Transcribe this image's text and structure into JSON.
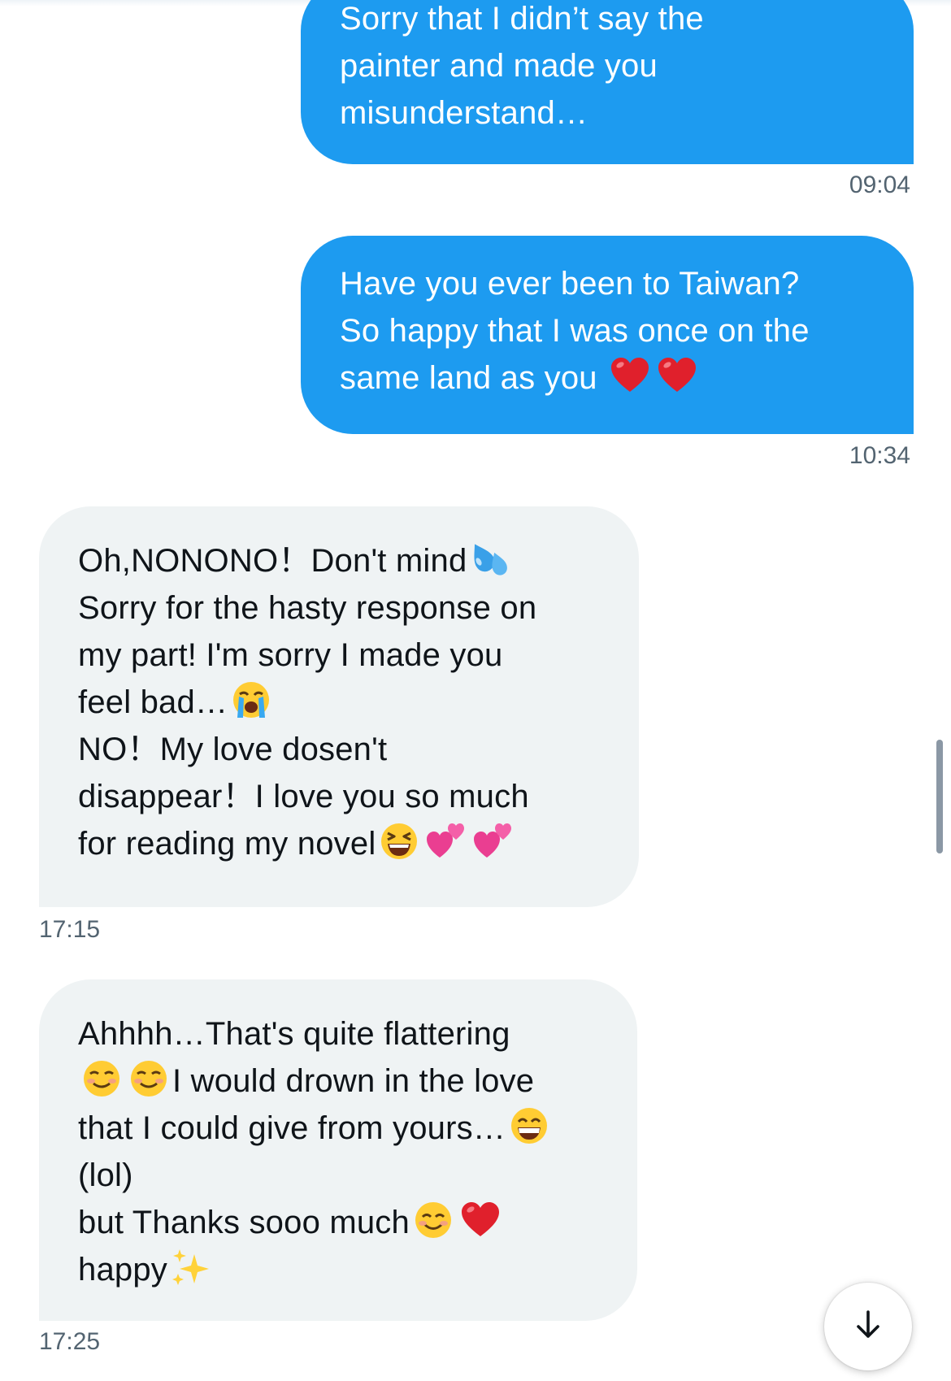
{
  "messages": [
    {
      "direction": "sent",
      "lines": [
        "Sorry that I didn’t say the",
        "painter and made you",
        "misunderstand…"
      ],
      "time": "09:04"
    },
    {
      "direction": "sent",
      "lines": [
        "Have you ever been to Taiwan?",
        "So happy that I was once on the",
        "same land as you"
      ],
      "trailing_emoji": [
        "red-heart",
        "red-heart"
      ],
      "time": "10:34"
    },
    {
      "direction": "received",
      "lines": [
        "Oh,NONONO！Don't mind",
        "Sorry for the hasty response on",
        "my part! I'm sorry I made you",
        "feel bad…",
        "NO！My love dosen't",
        "disappear！I love you so much",
        "for reading my novel"
      ],
      "line_emoji": {
        "0": [
          "sweat-droplets"
        ],
        "3": [
          "loudly-crying-face"
        ],
        "6": [
          "grinning-squinting-face",
          "two-hearts",
          "two-hearts"
        ]
      },
      "time": "17:15"
    },
    {
      "direction": "received",
      "lines": [
        "Ahhhh…That's quite flattering",
        "I would drown in the love",
        "that I could give from yours…",
        "(lol)",
        "but Thanks sooo much",
        "happy"
      ],
      "time": "17:25"
    }
  ],
  "colors": {
    "sent_bubble": "#1d9bf0",
    "received_bubble": "#eff3f4",
    "timestamp": "#536471"
  },
  "scroll_down_icon": "arrow-down-icon"
}
